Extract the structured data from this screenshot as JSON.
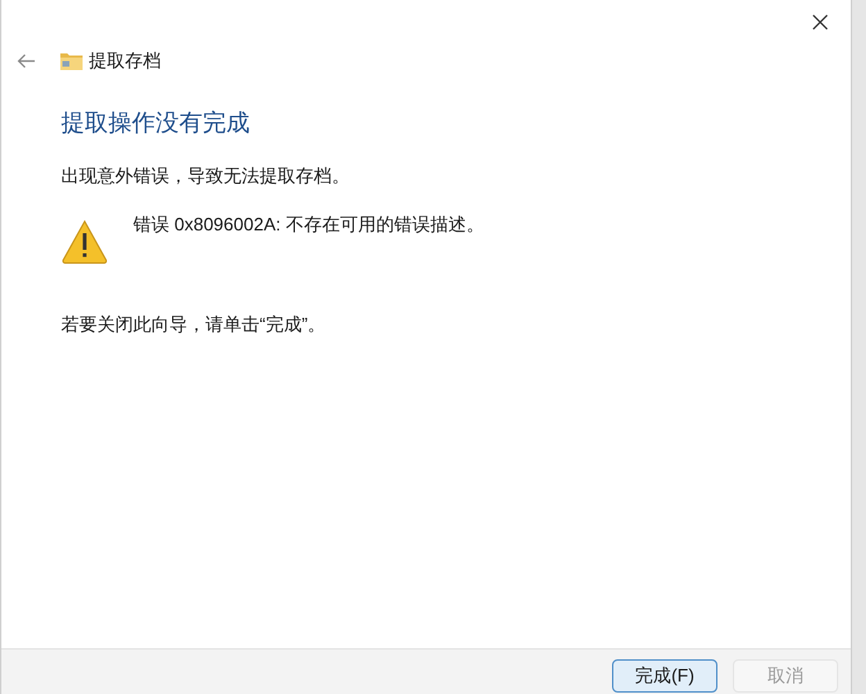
{
  "window": {
    "title": "提取存档"
  },
  "heading": "提取操作没有完成",
  "message": "出现意外错误，导致无法提取存档。",
  "error": {
    "kind": "warning",
    "text": "错误 0x8096002A: 不存在可用的错误描述。"
  },
  "instruction": "若要关闭此向导，请单击“完成”。",
  "buttons": [
    {
      "label": "完成(F)",
      "kind": "primary",
      "disabled": false
    },
    {
      "label": "取消",
      "kind": "secondary",
      "disabled": true
    }
  ]
}
